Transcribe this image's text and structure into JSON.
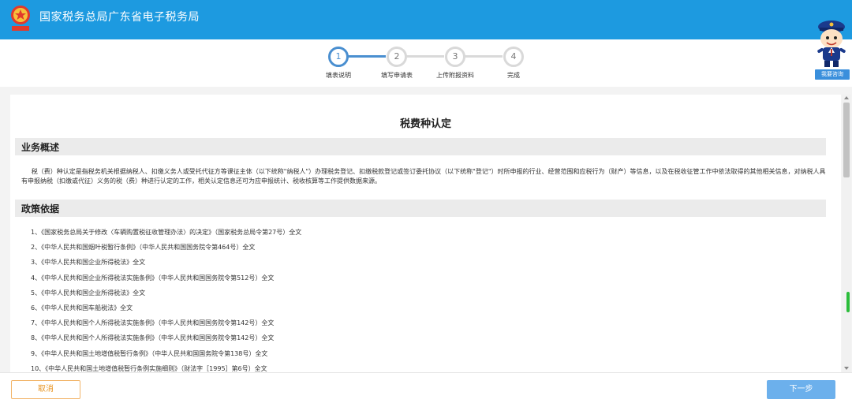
{
  "header": {
    "logo_caption": "国家税务总局",
    "title": "国家税务总局广东省电子税务局",
    "accent_color": "#1d9ae0"
  },
  "steps": [
    {
      "number": "1",
      "label": "填表说明",
      "active": true
    },
    {
      "number": "2",
      "label": "填写申请表",
      "active": false
    },
    {
      "number": "3",
      "label": "上传附报资料",
      "active": false
    },
    {
      "number": "4",
      "label": "完成",
      "active": false
    }
  ],
  "assistant": {
    "icon": "tax-officer-mascot-icon",
    "consult_label": "我要咨询"
  },
  "document": {
    "title": "税费种认定",
    "sections": {
      "overview": {
        "heading": "业务概述",
        "body": "税（费）种认定是指税务机关根据纳税人、扣缴义务人或受托代征方等课征主体（以下统称\"纳税人\"）办理税务登记、扣缴税款登记或签订委托协议（以下统称\"登记\"）时所申报的行业、经营范围和应税行为（财产）等信息，以及在税收征管工作中依法取得的其他相关信息，对纳税人具有申报纳税（扣缴或代征）义务的税（费）种进行认定的工作，相关认定信息还可为应申报统计、税收核算等工作提供数据来源。"
      },
      "policy": {
        "heading": "政策依据",
        "items": [
          "1、《国家税务总局关于修改〈车辆购置税征收管理办法〉的决定》（国家税务总局令第27号）全文",
          "2、《中华人民共和国烟叶税暂行条例》（中华人民共和国国务院令第464号）全文",
          "3、《中华人民共和国企业所得税法》全文",
          "4、《中华人民共和国企业所得税法实施条例》（中华人民共和国国务院令第512号）全文",
          "5、《中华人民共和国企业所得税法》全文",
          "6、《中华人民共和国车船税法》全文",
          "7、《中华人民共和国个人所得税法实施条例》（中华人民共和国国务院令第142号）全文",
          "8、《中华人民共和国个人所得税法实施条例》（中华人民共和国国务院令第142号）全文",
          "9、《中华人民共和国土地增值税暂行条例》（中华人民共和国国务院令第138号）全文",
          "10、《中华人民共和国土地增值税暂行条例实施细则》（财法字［1995］第6号）全文"
        ]
      }
    }
  },
  "footer": {
    "cancel_label": "取消",
    "next_label": "下一步"
  }
}
